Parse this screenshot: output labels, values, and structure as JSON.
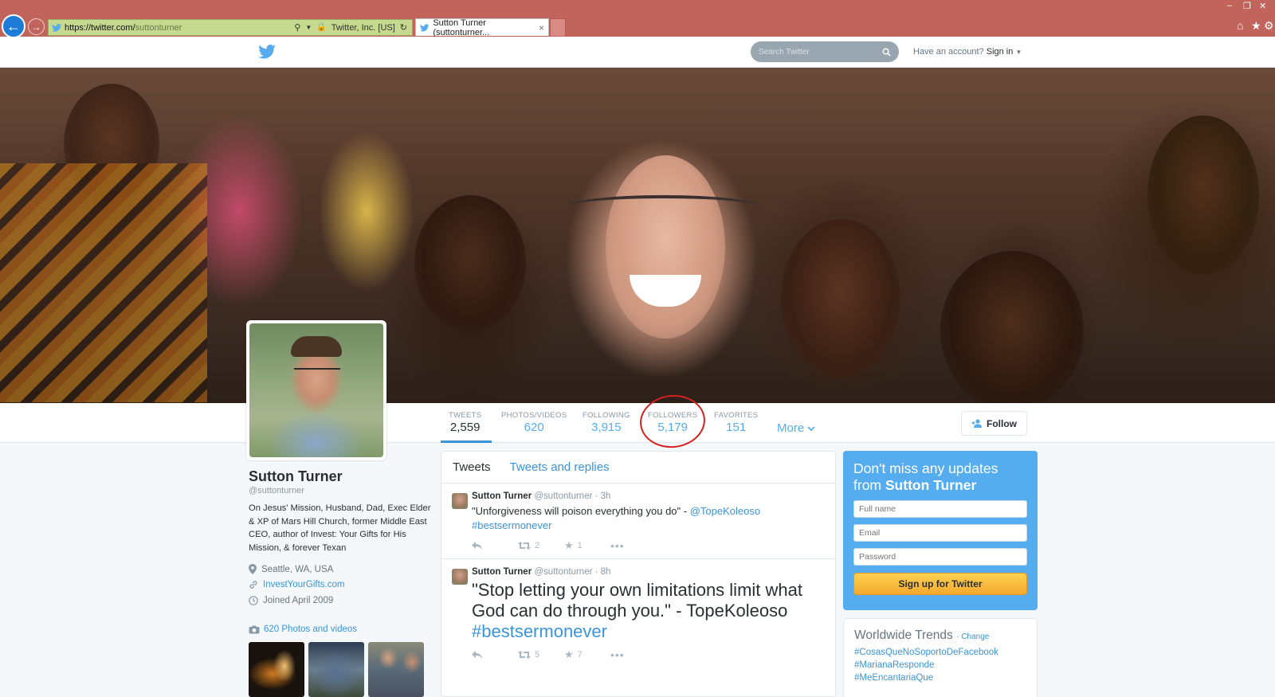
{
  "browser": {
    "url_main": "https://twitter.com/",
    "url_path": "suttonturner",
    "site_identity": "Twitter, Inc. [US]",
    "tab_title": "Sutton Turner (suttonturner..."
  },
  "topbar": {
    "search_placeholder": "Search Twitter",
    "have_account": "Have an account?",
    "sign_in": "Sign in"
  },
  "stats": [
    {
      "label": "TWEETS",
      "value": "2,559"
    },
    {
      "label": "PHOTOS/VIDEOS",
      "value": "620"
    },
    {
      "label": "FOLLOWING",
      "value": "3,915"
    },
    {
      "label": "FOLLOWERS",
      "value": "5,179"
    },
    {
      "label": "FAVORITES",
      "value": "151"
    }
  ],
  "more_label": "More",
  "follow_label": "Follow",
  "profile": {
    "name": "Sutton Turner",
    "handle": "@suttonturner",
    "bio": "On Jesus' Mission, Husband, Dad, Exec Elder & XP of Mars Hill Church, former Middle East CEO, author of Invest: Your Gifts for His Mission, & forever Texan",
    "location": "Seattle, WA, USA",
    "website": "InvestYourGifts.com",
    "joined": "Joined April 2009",
    "photos_link": "620 Photos and videos"
  },
  "timeline": {
    "tab_tweets": "Tweets",
    "tab_replies": "Tweets and replies",
    "tweets": [
      {
        "name": "Sutton Turner",
        "handle": "@suttonturner",
        "time": "· 3h",
        "text": "\"Unforgiveness will poison everything you do\" - ",
        "mention": "@TopeKoleoso",
        "hashtag": "#bestsermonever",
        "retweets": "2",
        "favorites": "1"
      },
      {
        "name": "Sutton Turner",
        "handle": "@suttonturner",
        "time": "· 8h",
        "text": "\"Stop letting your own limitations limit what God can do through you.\" - TopeKoleoso",
        "hashtag": "#bestsermonever",
        "retweets": "5",
        "favorites": "7"
      }
    ]
  },
  "signup": {
    "title_prefix": "Don't miss any updates from ",
    "title_name": "Sutton Turner",
    "full_name_placeholder": "Full name",
    "email_placeholder": "Email",
    "password_placeholder": "Password",
    "button": "Sign up for Twitter"
  },
  "trends": {
    "title": "Worldwide Trends",
    "change": "· Change",
    "items": [
      "#CosasQueNoSoportoDeFacebook",
      "#MarianaResponde",
      "#MeEncantariaQue"
    ]
  }
}
